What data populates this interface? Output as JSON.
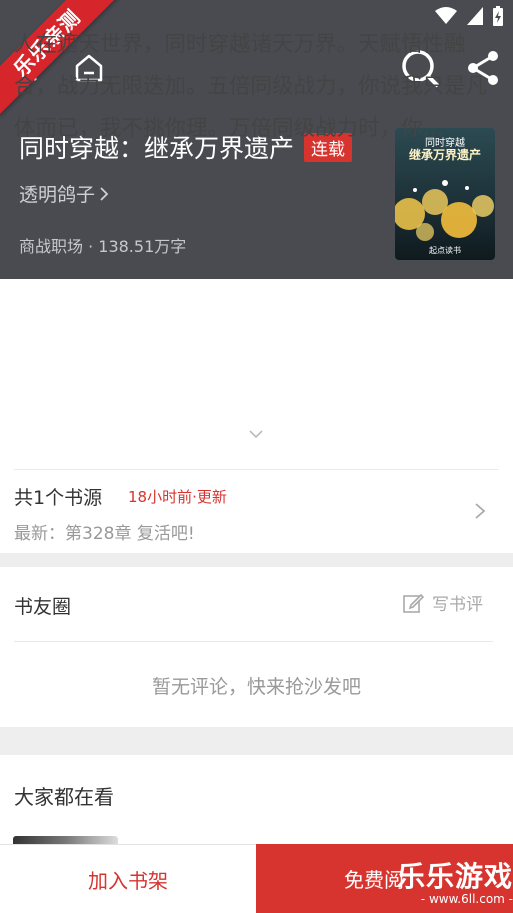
{
  "watermark": {
    "ribbon": "乐乐亲测",
    "brand": "乐乐游戏",
    "url": "- www.6ll.com -"
  },
  "book": {
    "title": "同时穿越：继承万界遗产",
    "status": "连载",
    "author": "透明鸽子",
    "meta": "商战职场 · 138.51万字",
    "cover": {
      "subtitle": "同时穿越",
      "title": "继承万界遗产",
      "publisher": "起点读书"
    },
    "synopsis": "人在遮天世界，同时穿越诸天万界。天赋悟性融合，战力无限迭加。五倍同级战力，你说我只是凡体而已，我不挑你理。万倍同级战力时，你…"
  },
  "source": {
    "title": "共1个书源",
    "updated": "18小时前·更新",
    "latest": "最新：第328章 复活吧!"
  },
  "forum": {
    "title": "书友圈",
    "write_label": "写书评",
    "empty_text": "暂无评论，快来抢沙发吧"
  },
  "popular": {
    "title": "大家都在看"
  },
  "actions": {
    "add_shelf": "加入书架",
    "read": "免费阅"
  },
  "colors": {
    "header_bg": "#4a4b51",
    "accent": "#d8342f"
  }
}
